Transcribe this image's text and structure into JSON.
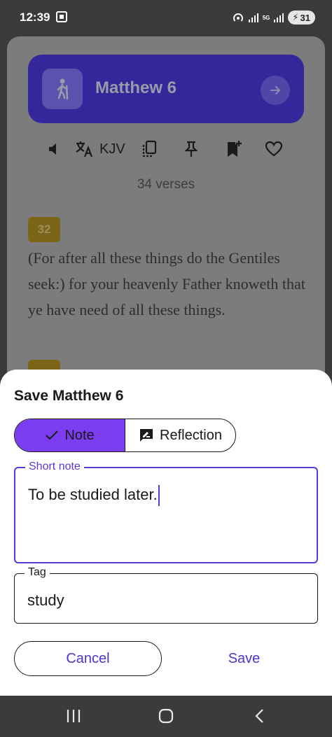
{
  "status_bar": {
    "time": "12:39",
    "net_label": "5G",
    "battery": "31",
    "icons": [
      "screenshot-icon",
      "hotspot-icon",
      "signal-icon",
      "signal-icon",
      "battery-charging-icon"
    ]
  },
  "background": {
    "chapter_title": "Matthew 6",
    "translation": "KJV",
    "verse_count": "34 verses",
    "verse_number": "32",
    "verse_text": "(For after all these things do the Gentiles seek:) for your heavenly Father knoweth that ye have need of all these things.",
    "toolbar_icons": [
      "volume-icon",
      "translate-icon",
      "copy-icon",
      "pin-icon",
      "bookmark-add-icon",
      "heart-icon"
    ]
  },
  "sheet": {
    "title": "Save Matthew 6",
    "segments": {
      "note_label": "Note",
      "reflection_label": "Reflection",
      "selected": "Note"
    },
    "short_note": {
      "label": "Short note",
      "value": "To be studied later."
    },
    "tag": {
      "label": "Tag",
      "value": "study"
    },
    "cancel_label": "Cancel",
    "save_label": "Save"
  },
  "colors": {
    "accent": "#7c3cf0",
    "link": "#4a36d0",
    "hero": "#34279b",
    "verse_badge": "#7c6516"
  },
  "nav_bar": {
    "icons": [
      "recents-icon",
      "home-icon",
      "back-icon"
    ]
  }
}
